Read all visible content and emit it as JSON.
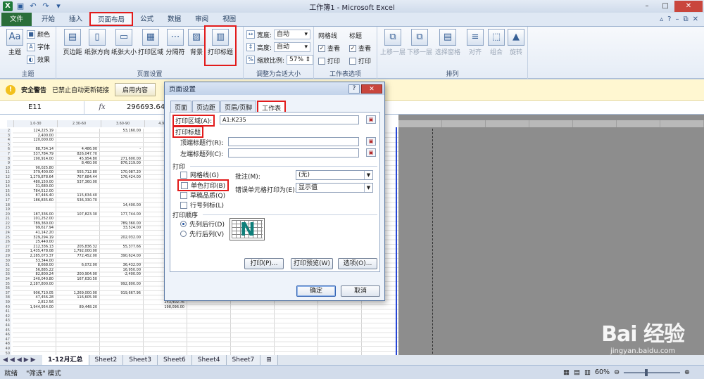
{
  "window": {
    "title": "工作簿1 - Microsoft Excel",
    "controls": [
      "–",
      "□",
      "✕"
    ]
  },
  "ribbon_tabs": [
    "文件",
    "开始",
    "插入",
    "页面布局",
    "公式",
    "数据",
    "审阅",
    "视图"
  ],
  "ribbon": {
    "theme_group": {
      "label": "主题",
      "theme_btn": "主题",
      "colors": "颜色",
      "fonts": "字体",
      "effects": "效果"
    },
    "page_setup_group": {
      "label": "页面设置",
      "buttons": [
        "页边距",
        "纸张方向",
        "纸张大小",
        "打印区域",
        "分隔符",
        "背景",
        "打印标题"
      ]
    },
    "scale_group": {
      "label": "调整为合适大小",
      "width_label": "宽度:",
      "width_value": "自动",
      "height_label": "高度:",
      "height_value": "自动",
      "scale_label": "缩放比例:",
      "scale_value": "57%"
    },
    "sheet_options_group": {
      "label": "工作表选项",
      "gridlines": "网格线",
      "headings": "标题",
      "view": "查看",
      "print": "打印"
    },
    "arrange_group": {
      "label": "排列",
      "buttons": [
        "上移一层",
        "下移一层",
        "选择窗格",
        "对齐",
        "组合",
        "旋转"
      ]
    }
  },
  "security_bar": {
    "title": "安全警告",
    "message": "已禁止自动更新链接",
    "button": "启用内容"
  },
  "formula_bar": {
    "name_box": "E11",
    "fx": "fx",
    "value": "296693.64"
  },
  "sheet": {
    "columns": [
      "A",
      "B",
      "C",
      "D",
      "E"
    ],
    "header_row": [
      "1.0-30",
      "2.30-60",
      "3.60-90",
      "4.90-180"
    ],
    "row_count": 51,
    "cells": [
      [
        "124,225.19",
        "",
        "53,160.00",
        ""
      ],
      [
        "2,400.00",
        "",
        "",
        ""
      ],
      [
        "120,000.00",
        "",
        "",
        ""
      ],
      [
        "",
        "",
        "",
        ""
      ],
      [
        "88,734.14",
        "4,486.00",
        "-",
        ""
      ],
      [
        "537,784.79",
        "826,047.70",
        "",
        ""
      ],
      [
        "190,914.00",
        "45,954.80",
        "271,600.00",
        ""
      ],
      [
        "",
        "8,460.00",
        "876,219.00",
        "296,693.64"
      ],
      [
        "90,025.80",
        "",
        "",
        ""
      ],
      [
        "379,400.00",
        "555,712.80",
        "170,087.20",
        ""
      ],
      [
        "1,279,878.64",
        "767,684.44",
        "176,424.00",
        ""
      ],
      [
        "480,150.00",
        "537,360.00",
        "",
        ""
      ],
      [
        "31,680.00",
        "",
        "",
        ""
      ],
      [
        "784,512.00",
        "",
        "",
        ""
      ],
      [
        "87,446.40",
        "115,634.40",
        "",
        ""
      ],
      [
        "186,835.60",
        "536,330.70",
        "",
        ""
      ],
      [
        "",
        "",
        "14,400.00",
        ""
      ],
      [
        "",
        "",
        "",
        ""
      ],
      [
        "187,336.00",
        "107,823.30",
        "177,744.00",
        ""
      ],
      [
        "101,252.00",
        "",
        "",
        ""
      ],
      [
        "789,360.00",
        "",
        "789,360.00",
        ""
      ],
      [
        "99,617.94",
        "",
        "33,524.00",
        ""
      ],
      [
        "41,142.20",
        "",
        "",
        ""
      ],
      [
        "329,294.19",
        "",
        "202,032.00",
        ""
      ],
      [
        "25,440.00",
        "",
        "",
        ""
      ],
      [
        "212,336.13",
        "205,836.32",
        "55,377.66",
        ""
      ],
      [
        "1,435,478.08",
        "1,792,000.00",
        "",
        ""
      ],
      [
        "2,285,073.37",
        "772,452.00",
        "390,624.00",
        ""
      ],
      [
        "53,344.00",
        "",
        "",
        ""
      ],
      [
        "8,668.00",
        "6,072.00",
        "36,432.00",
        ""
      ],
      [
        "56,885.22",
        "",
        "16,950.00",
        "441,321.92"
      ],
      [
        "82,800.24",
        "200,904.00",
        "-2,400.00",
        "354,089.95"
      ],
      [
        "240,040.80",
        "167,630.50",
        "",
        ""
      ],
      [
        "2,287,800.00",
        "",
        "992,800.00",
        ""
      ],
      [
        "",
        "",
        "",
        "9,248.00"
      ],
      [
        "906,710.05",
        "1,269,000.00",
        "919,667.96",
        ""
      ],
      [
        "47,456.28",
        "116,605.00",
        "",
        "164,785.16"
      ],
      [
        "2,812.56",
        "",
        "",
        "243,402.76"
      ],
      [
        "1,944,954.00",
        "89,448.20",
        "",
        "198,096.00"
      ]
    ]
  },
  "right_col_values": [
    "19",
    "00",
    "00",
    "00",
    "48",
    "00",
    "00",
    "00",
    "00",
    "00",
    "00",
    "00",
    "00",
    "00",
    "00",
    "00",
    "00",
    "00",
    "00",
    "00",
    "00",
    "00",
    "00",
    "00",
    "00",
    "00",
    "00",
    "00",
    "00",
    "00",
    "537,744.34",
    "605,364.17",
    "387,671.40",
    "3,190,600.00",
    "9,248.00",
    "3,002,198.27",
    "331,866.44",
    "245,915.32",
    "2,199,365.20"
  ],
  "dialog": {
    "title": "页面设置",
    "help": "?",
    "close": "✕",
    "tabs": [
      "页面",
      "页边距",
      "页眉/页脚",
      "工作表"
    ],
    "print_area_label": "打印区域(A):",
    "print_area_value": "A1:K235",
    "print_titles_label": "打印标题",
    "top_rows_label": "顶端标题行(R):",
    "left_cols_label": "左端标题列(C):",
    "print_section": "打印",
    "gridlines": "网格线(G)",
    "mono": "单色打印(B)",
    "draft": "草稿品质(Q)",
    "row_col_headers": "行号列标(L)",
    "comments_label": "批注(M):",
    "comments_value": "(无)",
    "errors_label": "错误单元格打印为(E):",
    "errors_value": "显示值",
    "order_section": "打印顺序",
    "down_then_over": "先列后行(D)",
    "over_then_down": "先行后列(V)",
    "print_btn": "打印(P)...",
    "preview_btn": "打印预览(W)",
    "options_btn": "选项(O)...",
    "ok_btn": "确定",
    "cancel_btn": "取消"
  },
  "sheet_tabs": [
    "1-12月汇总",
    "Sheet2",
    "Sheet3",
    "Sheet6",
    "Sheet4",
    "Sheet7"
  ],
  "status": {
    "ready": "就绪",
    "filter_mode": "\"筛选\" 模式",
    "zoom": "60%"
  },
  "watermark": {
    "brand": "Bai 经验",
    "url": "jingyan.baidu.com"
  }
}
